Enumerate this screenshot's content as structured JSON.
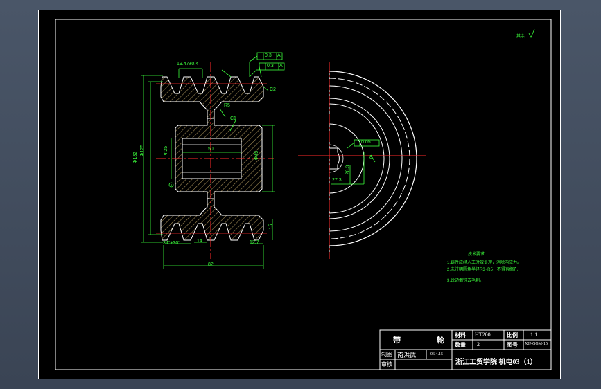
{
  "title_block": {
    "part_name_1": "带",
    "part_name_2": "轮",
    "material_label": "材料",
    "material_value": "HT200",
    "scale_label": "比例",
    "scale_value": "1:1",
    "quantity_label": "数量",
    "quantity_value": "2",
    "drawing_no_label": "图号",
    "drawing_no_value": "XJJ-GGM-15",
    "drawn_label": "制图",
    "drawn_name": "南洪武",
    "drawn_date": "06.4.15",
    "checked_label": "审核",
    "school": "浙江工贸学院 机电03（1）"
  },
  "dimensions": {
    "groove_pitch": "19.47±0.4",
    "runout1": "0.3",
    "runout2": "0.3",
    "datum": "A",
    "chamfer_c2": "C2",
    "chamfer_c1": "C1",
    "fillet_r5": "R5",
    "dia_outer": "Φ132",
    "dia_pitch": "Φ125",
    "dia_bore": "Φ25",
    "dia_hub": "Φ45",
    "hub_len": "50",
    "groove_angle": "34°±30'",
    "groove_width": "14",
    "total_width": "82",
    "groove_depth": "15",
    "edge": "12.7",
    "keyway_width": "8",
    "keyway_tol": "0.05",
    "keyway_depth": "27.3",
    "keyway_h": "28.3"
  },
  "notes": {
    "title": "技术要求",
    "line1": "1.铸件应经人工时效处理，消除内应力。",
    "line2": "2.未注明圆角半径R3~R5，不得有缩孔",
    "line3": "3.锐边倒钝去毛刺。"
  },
  "corner_mark": "其余"
}
